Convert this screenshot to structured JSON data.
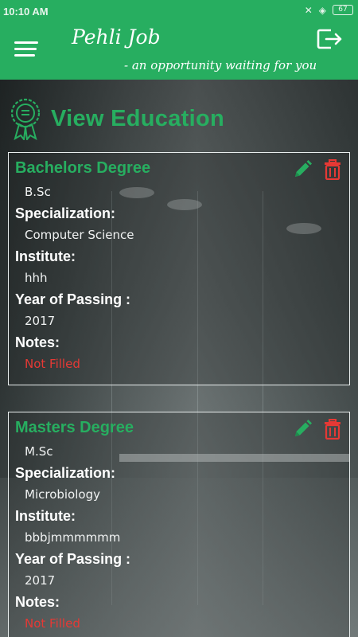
{
  "status_bar": {
    "time": "10:10 AM",
    "battery": "67"
  },
  "app": {
    "title": "Pehli Job",
    "tagline": "- an opportunity waiting for you"
  },
  "page": {
    "heading": "View Education"
  },
  "labels": {
    "specialization": "Specialization:",
    "institute": "Institute:",
    "year": "Year of Passing :",
    "notes": "Notes:"
  },
  "education": [
    {
      "degree_type": "Bachelors Degree",
      "degree": "B.Sc",
      "specialization": "Computer Science",
      "institute": "hhh",
      "year": "2017",
      "notes": "Not Filled"
    },
    {
      "degree_type": "Masters Degree",
      "degree": "M.Sc",
      "specialization": "Microbiology",
      "institute": "bbbjmmmmmm",
      "year": "2017",
      "notes": "Not Filled"
    }
  ],
  "colors": {
    "primary": "#27ae60",
    "delete": "#e53935",
    "empty_value": "#e53935"
  },
  "icons": {
    "menu": "menu-icon",
    "logout": "logout-icon",
    "badge": "certificate-badge-icon",
    "edit": "pencil-icon",
    "delete": "trash-icon"
  }
}
